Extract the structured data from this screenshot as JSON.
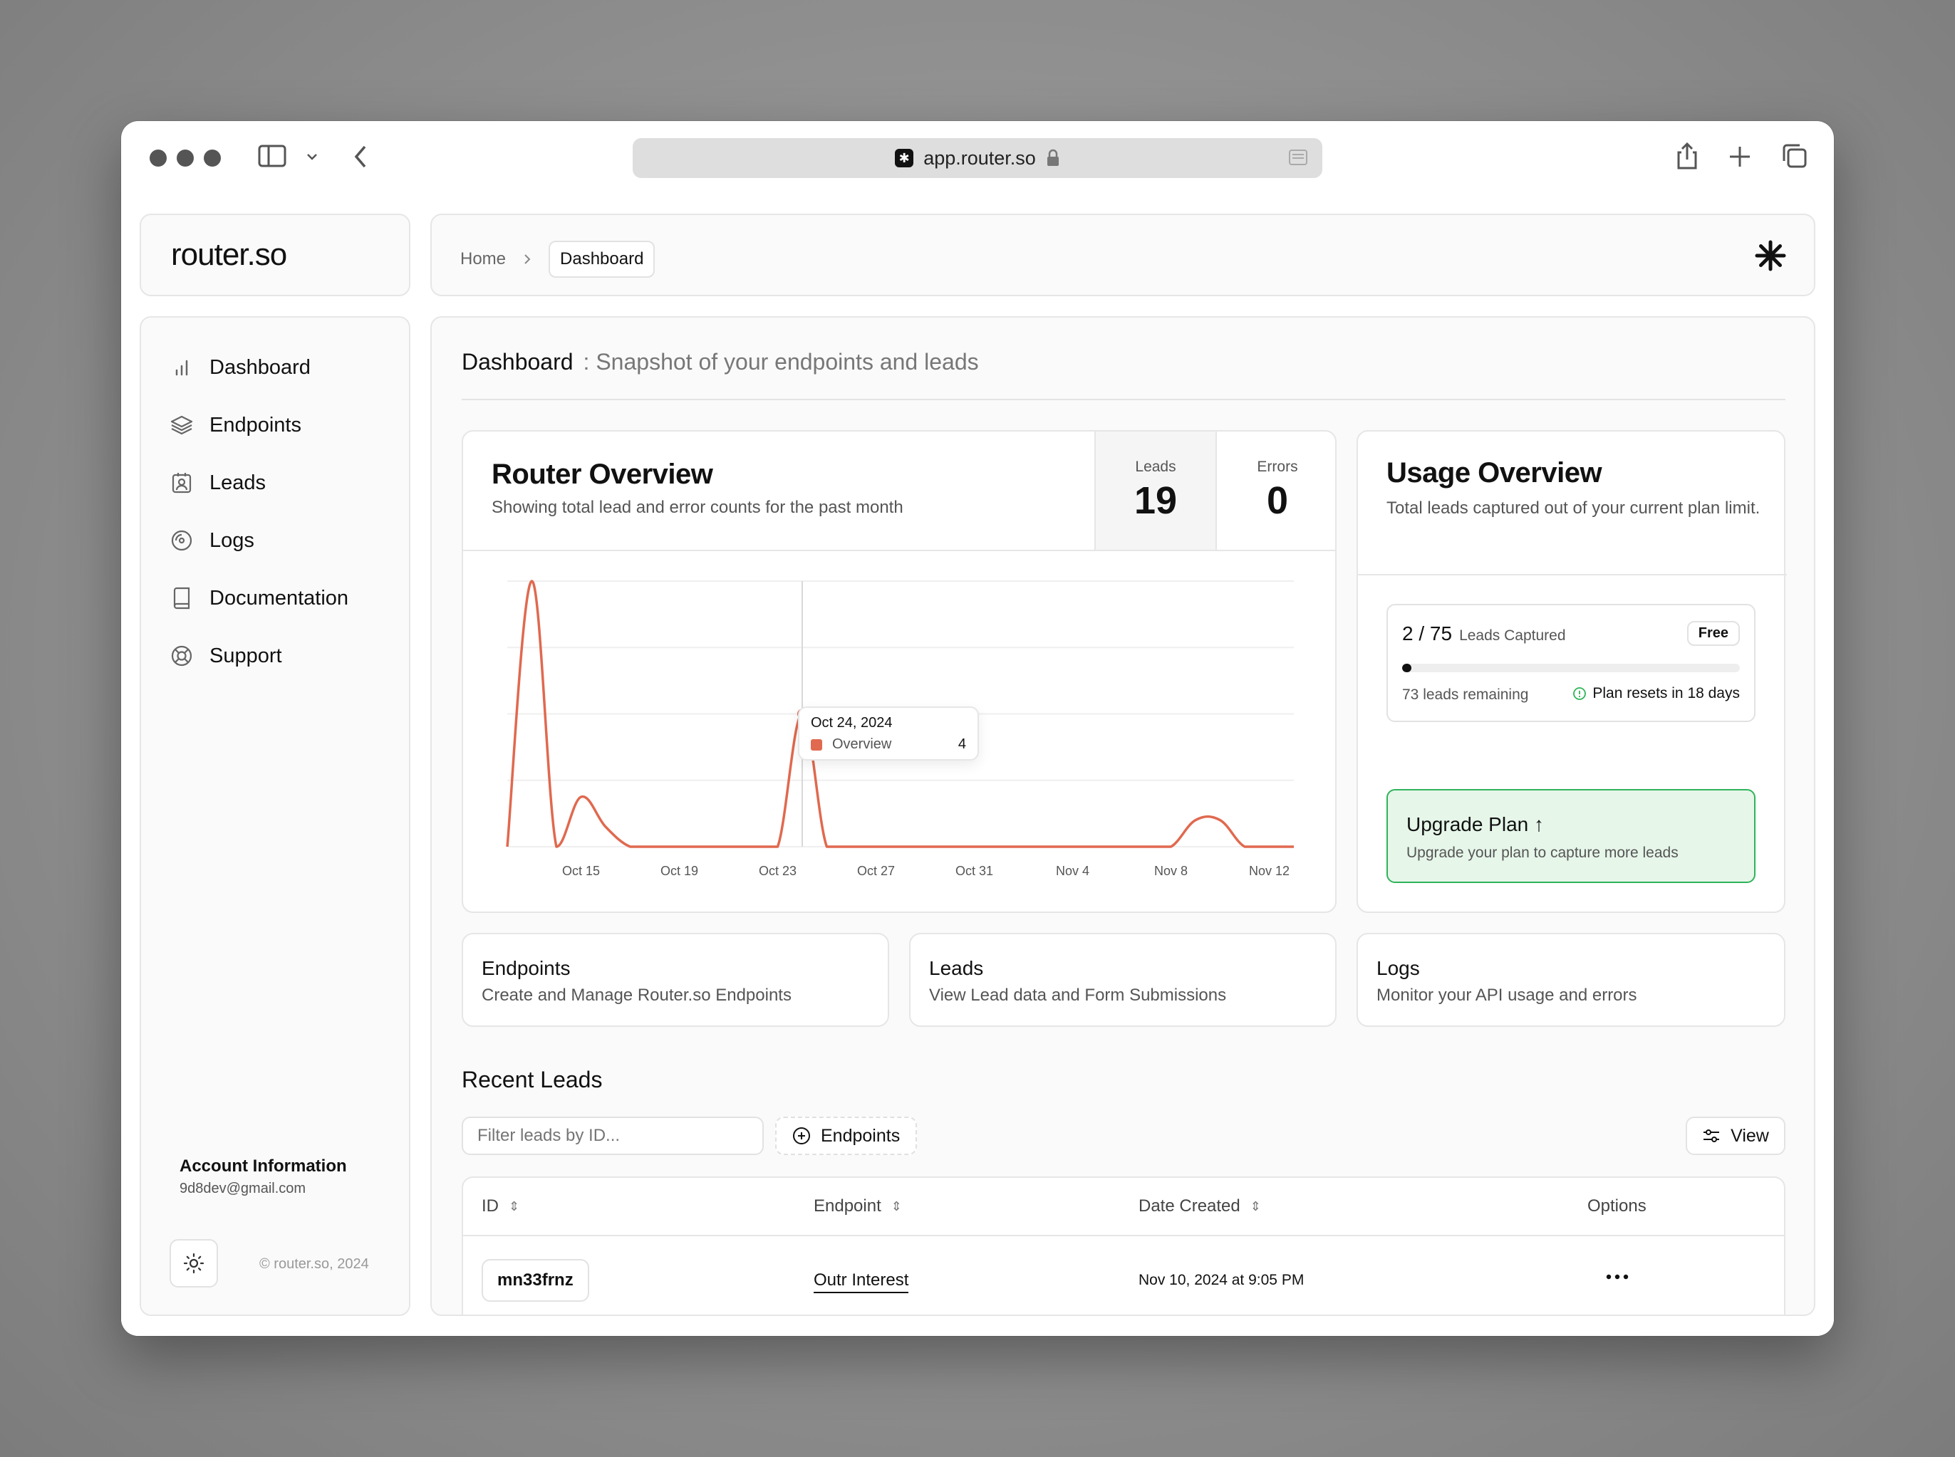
{
  "browser": {
    "url": "app.router.so"
  },
  "sidebar": {
    "logo": "router.so",
    "items": [
      {
        "label": "Dashboard",
        "icon": "bar-chart-icon"
      },
      {
        "label": "Endpoints",
        "icon": "layers-icon"
      },
      {
        "label": "Leads",
        "icon": "contact-icon"
      },
      {
        "label": "Logs",
        "icon": "disc-icon"
      },
      {
        "label": "Documentation",
        "icon": "book-icon"
      },
      {
        "label": "Support",
        "icon": "life-buoy-icon"
      }
    ],
    "account_title": "Account Information",
    "account_email": "9d8dev@gmail.com",
    "copyright": "© router.so, 2024"
  },
  "header": {
    "breadcrumb_home": "Home",
    "breadcrumb_current": "Dashboard"
  },
  "page": {
    "title": "Dashboard",
    "subtitle": ": Snapshot of your endpoints and leads"
  },
  "router_overview": {
    "title": "Router Overview",
    "subtitle": "Showing total lead and error counts for the past month",
    "leads_label": "Leads",
    "leads_value": "19",
    "errors_label": "Errors",
    "errors_value": "0",
    "tooltip_date": "Oct 24, 2024",
    "tooltip_series": "Overview",
    "tooltip_value": "4"
  },
  "chart_data": {
    "type": "area",
    "x_tick_labels": [
      "Oct 15",
      "Oct 19",
      "Oct 23",
      "Oct 27",
      "Oct 31",
      "Nov 4",
      "Nov 8",
      "Nov 12"
    ],
    "series": [
      {
        "name": "Overview",
        "color": "#e0694f",
        "points": [
          [
            "Oct 12",
            0
          ],
          [
            "Oct 13",
            8
          ],
          [
            "Oct 14",
            0
          ],
          [
            "Oct 15",
            1.5
          ],
          [
            "Oct 16",
            0.6
          ],
          [
            "Oct 17",
            0
          ],
          [
            "Oct 18",
            0
          ],
          [
            "Oct 19",
            0
          ],
          [
            "Oct 20",
            0
          ],
          [
            "Oct 21",
            0
          ],
          [
            "Oct 22",
            0
          ],
          [
            "Oct 23",
            0
          ],
          [
            "Oct 24",
            4
          ],
          [
            "Oct 25",
            0
          ],
          [
            "Oct 26",
            0
          ],
          [
            "Oct 27",
            0
          ],
          [
            "Oct 28",
            0
          ],
          [
            "Oct 29",
            0
          ],
          [
            "Oct 30",
            0
          ],
          [
            "Oct 31",
            0
          ],
          [
            "Nov 1",
            0
          ],
          [
            "Nov 2",
            0
          ],
          [
            "Nov 3",
            0
          ],
          [
            "Nov 4",
            0
          ],
          [
            "Nov 5",
            0
          ],
          [
            "Nov 6",
            0
          ],
          [
            "Nov 7",
            0
          ],
          [
            "Nov 8",
            0
          ],
          [
            "Nov 9",
            0.8
          ],
          [
            "Nov 10",
            0.8
          ],
          [
            "Nov 11",
            0
          ],
          [
            "Nov 12",
            0
          ],
          [
            "Nov 13",
            0
          ]
        ]
      }
    ],
    "ylim": [
      0,
      8
    ],
    "grid": true,
    "highlight": {
      "x": "Oct 24",
      "y": 4
    }
  },
  "usage": {
    "title": "Usage Overview",
    "subtitle": "Total leads captured out of your current plan limit.",
    "captured_count": "2 / 75",
    "captured_label": "Leads Captured",
    "plan_badge": "Free",
    "progress_fraction": 0.027,
    "remaining": "73 leads remaining",
    "reset": "Plan resets in 18 days",
    "upgrade_title": "Upgrade Plan ↑",
    "upgrade_subtitle": "Upgrade your plan to capture more leads",
    "accent_green": "#2fb45a"
  },
  "quick_links": [
    {
      "title": "Endpoints",
      "subtitle": "Create and Manage Router.so Endpoints"
    },
    {
      "title": "Leads",
      "subtitle": "View Lead data and Form Submissions"
    },
    {
      "title": "Logs",
      "subtitle": "Monitor your API usage and errors"
    }
  ],
  "recent_leads": {
    "title": "Recent Leads",
    "filter_placeholder": "Filter leads by ID...",
    "endpoints_filter": "Endpoints",
    "view_button": "View",
    "columns": [
      "ID",
      "Endpoint",
      "Date Created",
      "Options"
    ],
    "rows": [
      {
        "id": "mn33frnz",
        "endpoint": "Outr Interest",
        "date": "Nov 10, 2024 at 9:05 PM"
      }
    ]
  }
}
